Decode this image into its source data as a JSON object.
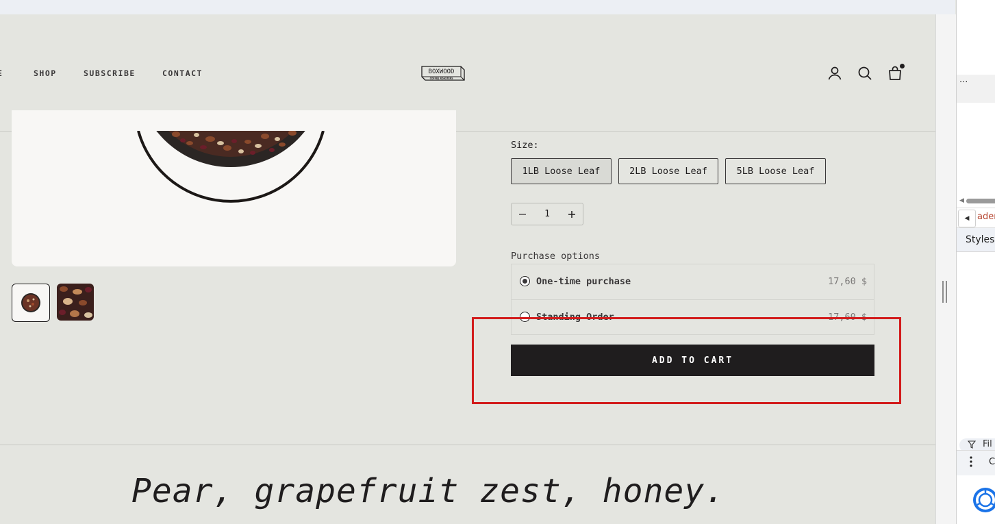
{
  "nav": {
    "links": [
      "E",
      "SHOP",
      "SUBSCRIBE",
      "CONTACT"
    ]
  },
  "logo": {
    "text": "BOXWOOD",
    "subtext": "COFFEE ROASTERS"
  },
  "header_icons": [
    "account-icon",
    "search-icon",
    "cart-icon"
  ],
  "product": {
    "size_label": "Size:",
    "sizes": [
      "1LB Loose Leaf",
      "2LB Loose Leaf",
      "5LB Loose Leaf"
    ],
    "selected_size": "1LB Loose Leaf",
    "quantity": "1",
    "purchase_label": "Purchase options",
    "options": [
      {
        "label": "One-time purchase",
        "price": "17,60 $",
        "selected": true
      },
      {
        "label": "Standing Order",
        "price": "17,60 $",
        "selected": false
      }
    ],
    "add_to_cart": "ADD TO CART",
    "tagline": "Pear, grapefruit zest, honey."
  },
  "devtools": {
    "more": "···",
    "breadcrumb": "ader",
    "tab": "Styles",
    "filter": "Fil",
    "console": "C"
  },
  "colors": {
    "page_bg": "#e4e5e0",
    "button_bg": "#1f1d1e",
    "highlight": "#d21b1b"
  }
}
